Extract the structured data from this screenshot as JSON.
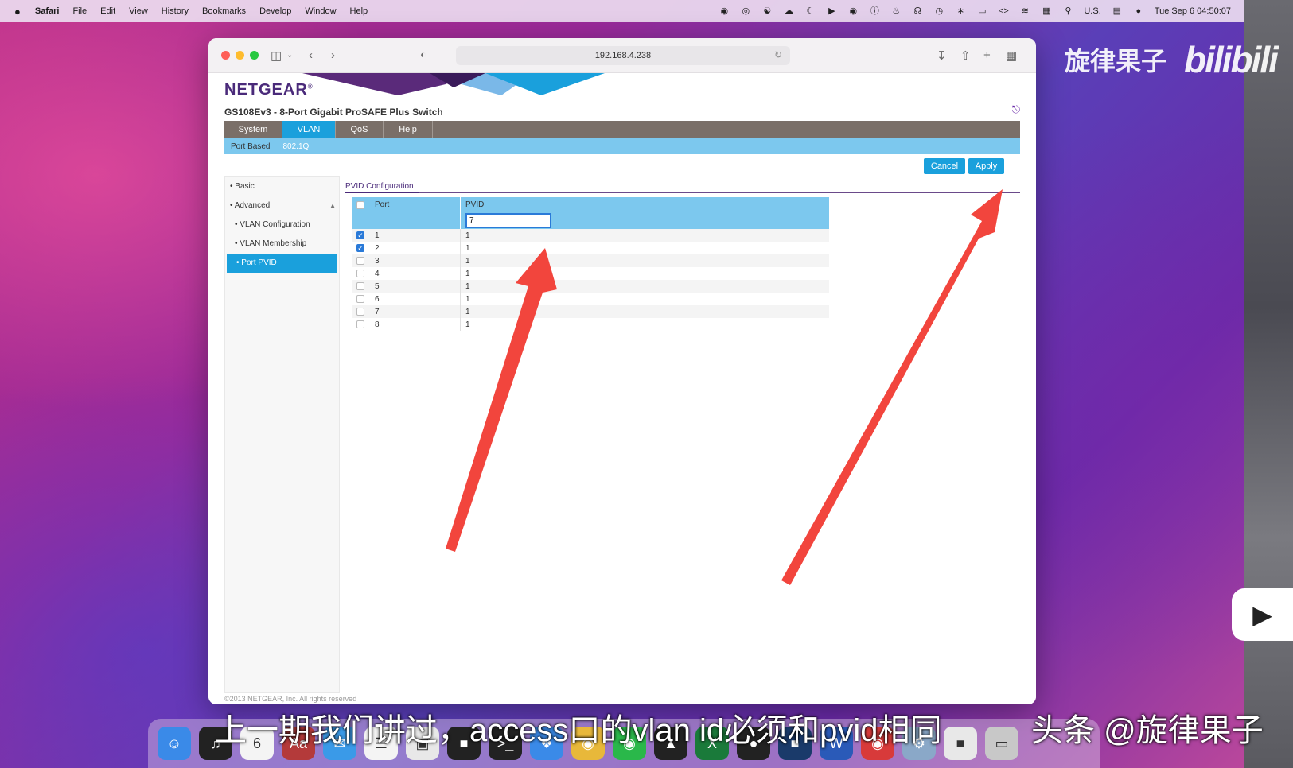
{
  "menubar": {
    "apple": "",
    "app": "Safari",
    "items": [
      "File",
      "Edit",
      "View",
      "History",
      "Bookmarks",
      "Develop",
      "Window",
      "Help"
    ],
    "input_source": "U.S.",
    "clock": "Tue Sep 6  04:50:07"
  },
  "watermark": {
    "channel": "旋律果子",
    "brand": "bilibili"
  },
  "browser": {
    "url": "192.168.4.238"
  },
  "netgear": {
    "logo": "NETGEAR",
    "product": "GS108Ev3 - 8-Port Gigabit ProSAFE Plus Switch",
    "nav": [
      "System",
      "VLAN",
      "QoS",
      "Help"
    ],
    "subnav": [
      "Port Based",
      "802.1Q"
    ],
    "cancel_label": "Cancel",
    "apply_label": "Apply",
    "sidebar": [
      "Basic",
      "Advanced",
      "VLAN Configuration",
      "VLAN Membership",
      "Port PVID"
    ],
    "section_title": "PVID Configuration",
    "table": {
      "col_port": "Port",
      "col_pvid": "PVID",
      "edit_value": "7",
      "rows": [
        {
          "port": "1",
          "pvid": "1",
          "checked": true
        },
        {
          "port": "2",
          "pvid": "1",
          "checked": true
        },
        {
          "port": "3",
          "pvid": "1",
          "checked": false
        },
        {
          "port": "4",
          "pvid": "1",
          "checked": false
        },
        {
          "port": "5",
          "pvid": "1",
          "checked": false
        },
        {
          "port": "6",
          "pvid": "1",
          "checked": false
        },
        {
          "port": "7",
          "pvid": "1",
          "checked": false
        },
        {
          "port": "8",
          "pvid": "1",
          "checked": false
        }
      ]
    },
    "footer": "©2013 NETGEAR, Inc. All rights reserved"
  },
  "subtitle": "上一期我们讲过，access口的vlan id必须和pvid相同",
  "credit": "头条 @旋律果子",
  "colors": {
    "accent": "#1aa0dc",
    "nav_bg": "#7a6f68",
    "arrow": "#f2453d"
  }
}
